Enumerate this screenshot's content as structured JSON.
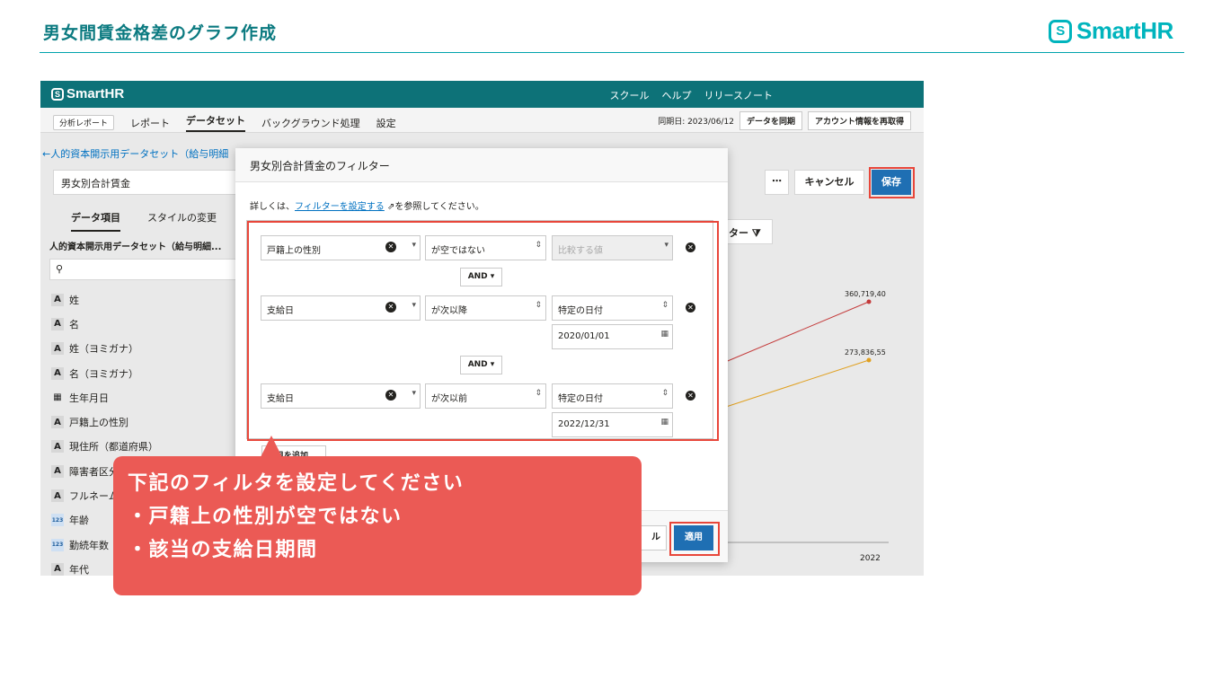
{
  "slide": {
    "title": "男女間賃金格差のグラフ作成",
    "brand": "SmartHR"
  },
  "app": {
    "logo": "SmartHR",
    "nav": [
      "スクール",
      "ヘルプ",
      "リリースノート"
    ],
    "tabs": {
      "chip": "分析レポート",
      "report": "レポート",
      "dataset": "データセット",
      "bg": "バックグラウンド処理",
      "settings": "設定"
    },
    "sync_date": "同期日: 2023/06/12",
    "sync_btn": "データを同期",
    "refetch_btn": "アカウント情報を再取得",
    "back_link": "人的資本開示用データセット（給与明細",
    "name_value": "男女別合計賃金",
    "left_tabs": [
      "データ項目",
      "スタイルの変更"
    ],
    "dataset_name": "人的資本開示用データセット（給与明細...",
    "fields": [
      {
        "type": "A",
        "label": "姓"
      },
      {
        "type": "A",
        "label": "名"
      },
      {
        "type": "A",
        "label": "姓（ヨミガナ）"
      },
      {
        "type": "A",
        "label": "名（ヨミガナ）"
      },
      {
        "type": "cal",
        "label": "生年月日"
      },
      {
        "type": "A",
        "label": "戸籍上の性別"
      },
      {
        "type": "A",
        "label": "現住所（都道府県）"
      },
      {
        "type": "A",
        "label": "障害者区分"
      },
      {
        "type": "A",
        "label": "フルネーム"
      },
      {
        "type": "123",
        "label": "年齢"
      },
      {
        "type": "123",
        "label": "勤続年数"
      },
      {
        "type": "A",
        "label": "年代"
      }
    ],
    "more": "⋯",
    "cancel": "キャンセル",
    "save": "保存",
    "filter_chip": "ター",
    "chart_values": [
      "360,719,40",
      "273,836,55"
    ],
    "chart_x": "2022"
  },
  "modal": {
    "title": "男女別合計賃金のフィルター",
    "note_prefix": "詳しくは、",
    "note_link": "フィルターを設定する",
    "note_suffix": "を参照してください。",
    "rules": [
      {
        "field": "戸籍上の性別",
        "op": "が空ではない",
        "value": "比較する値"
      },
      {
        "field": "支給日",
        "op": "が次以降",
        "value": "特定の日付",
        "date": "2020/01/01"
      },
      {
        "field": "支給日",
        "op": "が次以前",
        "value": "特定の日付",
        "date": "2022/12/31"
      }
    ],
    "and": "AND",
    "add": "項目を追加",
    "cancel_frag": "ル",
    "apply": "適用"
  },
  "callout": {
    "lines": [
      "下記のフィルタを設定してください",
      "・戸籍上の性別が空ではない",
      "・該当の支給日期間"
    ]
  },
  "colors": {
    "accent": "#00b4bd",
    "highlight": "#e8463a",
    "callout": "#eb5a55",
    "primary": "#1f6fb3"
  }
}
